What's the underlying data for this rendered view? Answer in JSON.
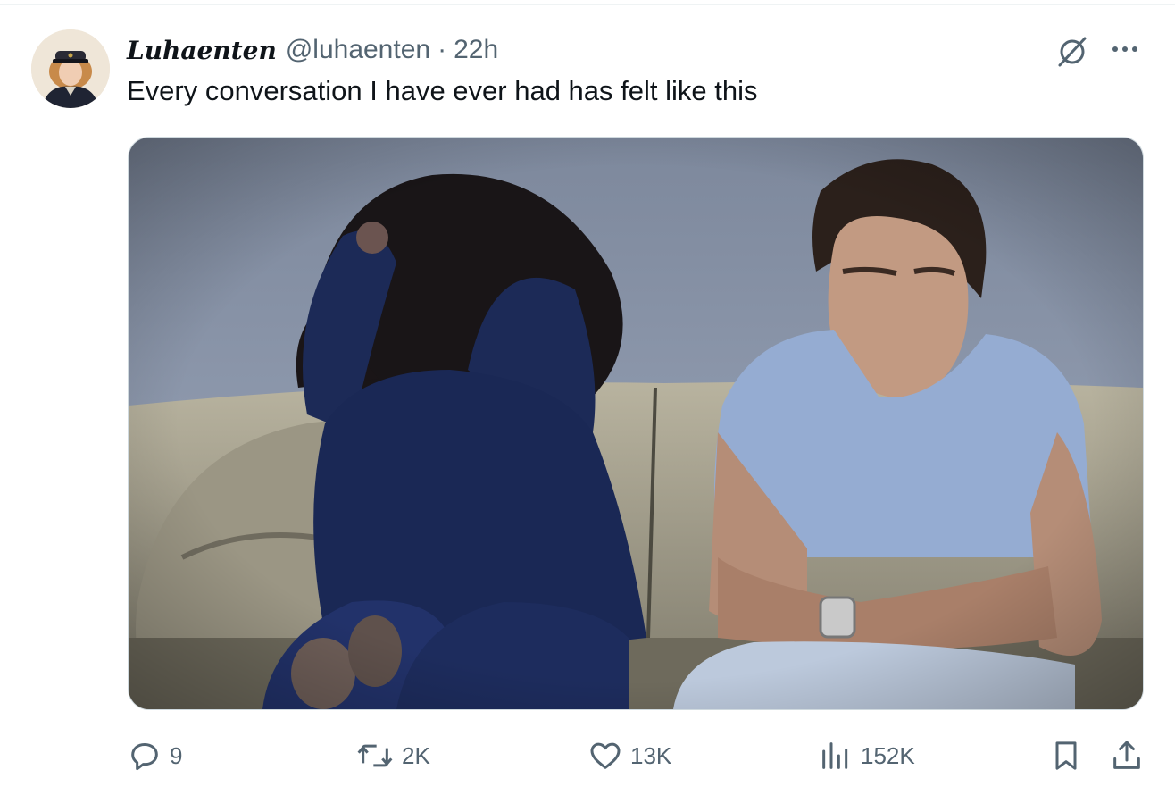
{
  "tweet": {
    "display_name": "Luhaenten",
    "handle": "@luhaenten",
    "separator": "·",
    "timestamp": "22h",
    "text": "Every conversation I have ever had has felt like this"
  },
  "media": {
    "description_icon": "photo",
    "dominant_colors": [
      "#7f8aa0",
      "#c9c4b2",
      "#1b2a58",
      "#9ab0d2"
    ]
  },
  "actions": {
    "replies": "9",
    "retweets": "2K",
    "likes": "13K",
    "views": "152K"
  },
  "icons": {
    "grok": "grok-icon",
    "more": "more-icon",
    "reply": "reply-icon",
    "retweet": "retweet-icon",
    "like": "heart-icon",
    "views": "analytics-icon",
    "bookmark": "bookmark-icon",
    "share": "share-icon"
  },
  "colors": {
    "secondary_text": "#536471",
    "primary_text": "#0f1419",
    "border": "#cfd9de"
  }
}
